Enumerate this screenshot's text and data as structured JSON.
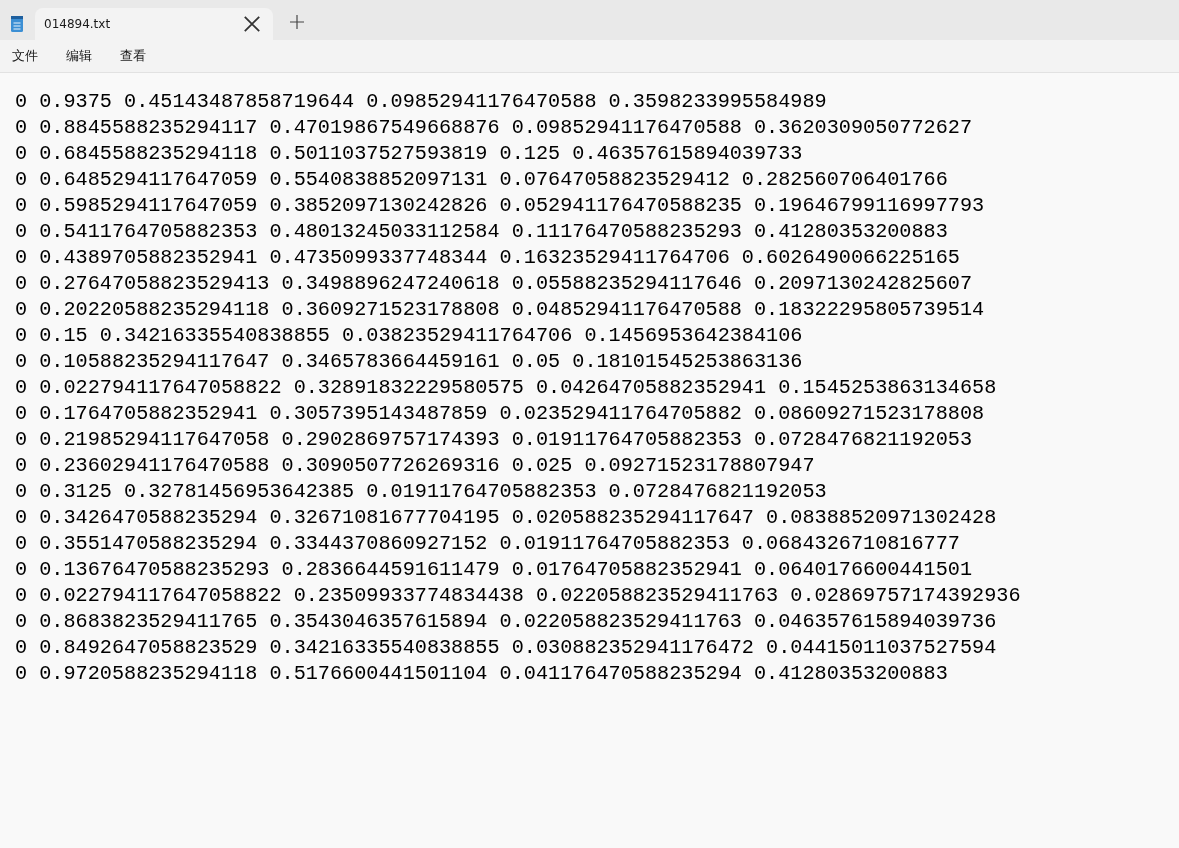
{
  "tab": {
    "title": "014894.txt",
    "selected": true
  },
  "menu": [
    "文件",
    "编辑",
    "查看"
  ],
  "lines": [
    "0 0.9375 0.45143487858719644 0.09852941176470588 0.3598233995584989",
    "0 0.8845588235294117 0.47019867549668876 0.09852941176470588 0.3620309050772627",
    "0 0.6845588235294118 0.5011037527593819 0.125 0.46357615894039733",
    "0 0.6485294117647059 0.5540838852097131 0.07647058823529412 0.282560706401766",
    "0 0.5985294117647059 0.3852097130242826 0.052941176470588235 0.19646799116997793",
    "0 0.5411764705882353 0.48013245033112584 0.11176470588235293 0.41280353200883",
    "0 0.4389705882352941 0.4735099337748344 0.16323529411764706 0.6026490066225165",
    "0 0.27647058823529413 0.3498896247240618 0.05588235294117646 0.2097130242825607",
    "0 0.20220588235294118 0.3609271523178808 0.04852941176470588 0.18322295805739514",
    "0 0.15 0.34216335540838855 0.03823529411764706 0.1456953642384106",
    "0 0.10588235294117647 0.3465783664459161 0.05 0.18101545253863136",
    "0 0.022794117647058822 0.32891832229580575 0.04264705882352941 0.1545253863134658",
    "0 0.1764705882352941 0.3057395143487859 0.023529411764705882 0.08609271523178808",
    "0 0.21985294117647058 0.2902869757174393 0.01911764705882353 0.0728476821192053",
    "0 0.23602941176470588 0.3090507726269316 0.025 0.09271523178807947",
    "0 0.3125 0.32781456953642385 0.01911764705882353 0.0728476821192053",
    "0 0.3426470588235294 0.32671081677704195 0.020588235294117647 0.08388520971302428",
    "0 0.3551470588235294 0.3344370860927152 0.01911764705882353 0.0684326710816777",
    "0 0.13676470588235293 0.2836644591611479 0.01764705882352941 0.0640176600441501",
    "0 0.022794117647058822 0.23509933774834438 0.022058823529411763 0.02869757174392936",
    "0 0.8683823529411765 0.3543046357615894 0.022058823529411763 0.046357615894039736",
    "0 0.8492647058823529 0.34216335540838855 0.030882352941176472 0.04415011037527594",
    "0 0.9720588235294118 0.5176600441501104 0.041176470588235294 0.41280353200883"
  ]
}
